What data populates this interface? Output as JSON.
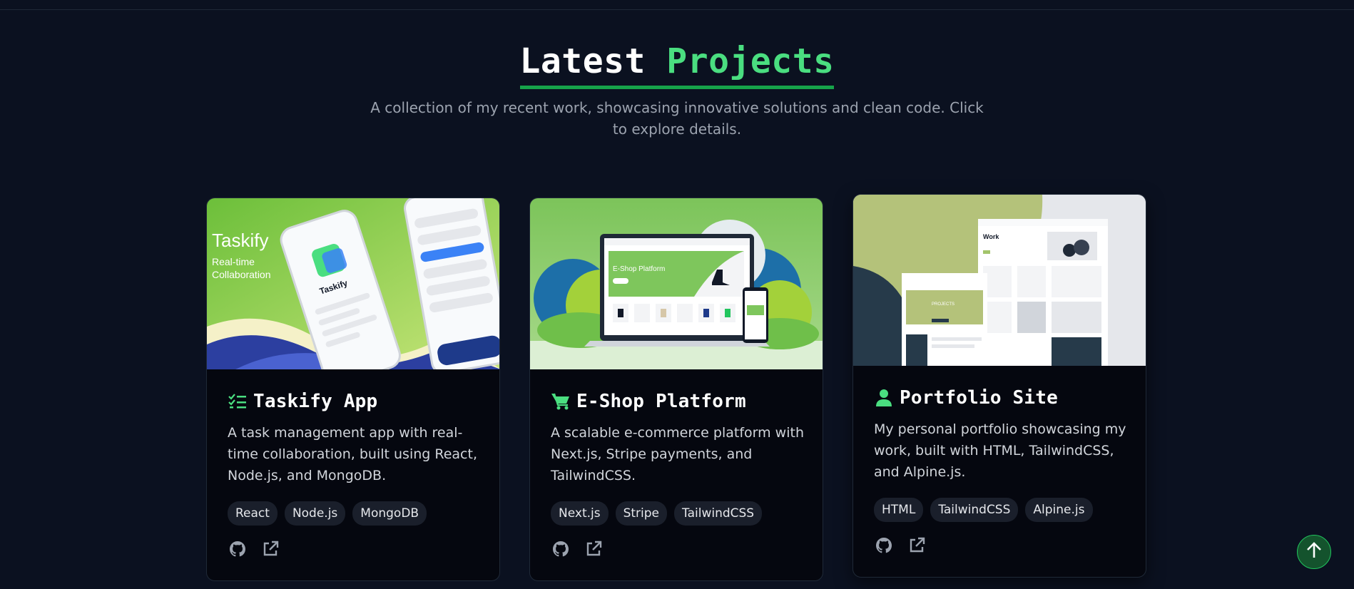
{
  "section": {
    "title_main": "Latest",
    "title_accent": "Projects",
    "subtitle": "A collection of my recent work, showcasing innovative solutions and clean code. Click to explore details."
  },
  "projects": [
    {
      "icon": "checklist-icon",
      "title": "Taskify App",
      "description": "A task management app with real-time collaboration, built using React, Node.js, and MongoDB.",
      "tags": [
        "React",
        "Node.js",
        "MongoDB"
      ],
      "thumb": {
        "heading": "Taskify",
        "tagline_1": "Real-time",
        "tagline_2": "Collaboration",
        "phone_label": "Taskify"
      }
    },
    {
      "icon": "shopping-cart-icon",
      "title": "E-Shop Platform",
      "description": "A scalable e-commerce platform with Next.js, Stripe payments, and TailwindCSS.",
      "tags": [
        "Next.js",
        "Stripe",
        "TailwindCSS"
      ],
      "thumb": {
        "screen_heading": "E-Shop Platform"
      }
    },
    {
      "icon": "user-icon",
      "title": "Portfolio Site",
      "description": "My personal portfolio showcasing my work, built with HTML, TailwindCSS, and Alpine.js.",
      "tags": [
        "HTML",
        "TailwindCSS",
        "Alpine.js"
      ],
      "thumb": {
        "page_heading": "Work",
        "front_heading": "PROJECTS"
      }
    }
  ],
  "links": {
    "github_icon": "github-icon",
    "external_icon": "external-link-icon"
  },
  "scroll_top_icon": "arrow-up-icon",
  "colors": {
    "background": "#0b1120",
    "card": "#05070f",
    "accent": "#4ade80",
    "accent_dark": "#16a34a",
    "muted_text": "#9ca3af",
    "tag_bg": "#1a1f2b"
  }
}
